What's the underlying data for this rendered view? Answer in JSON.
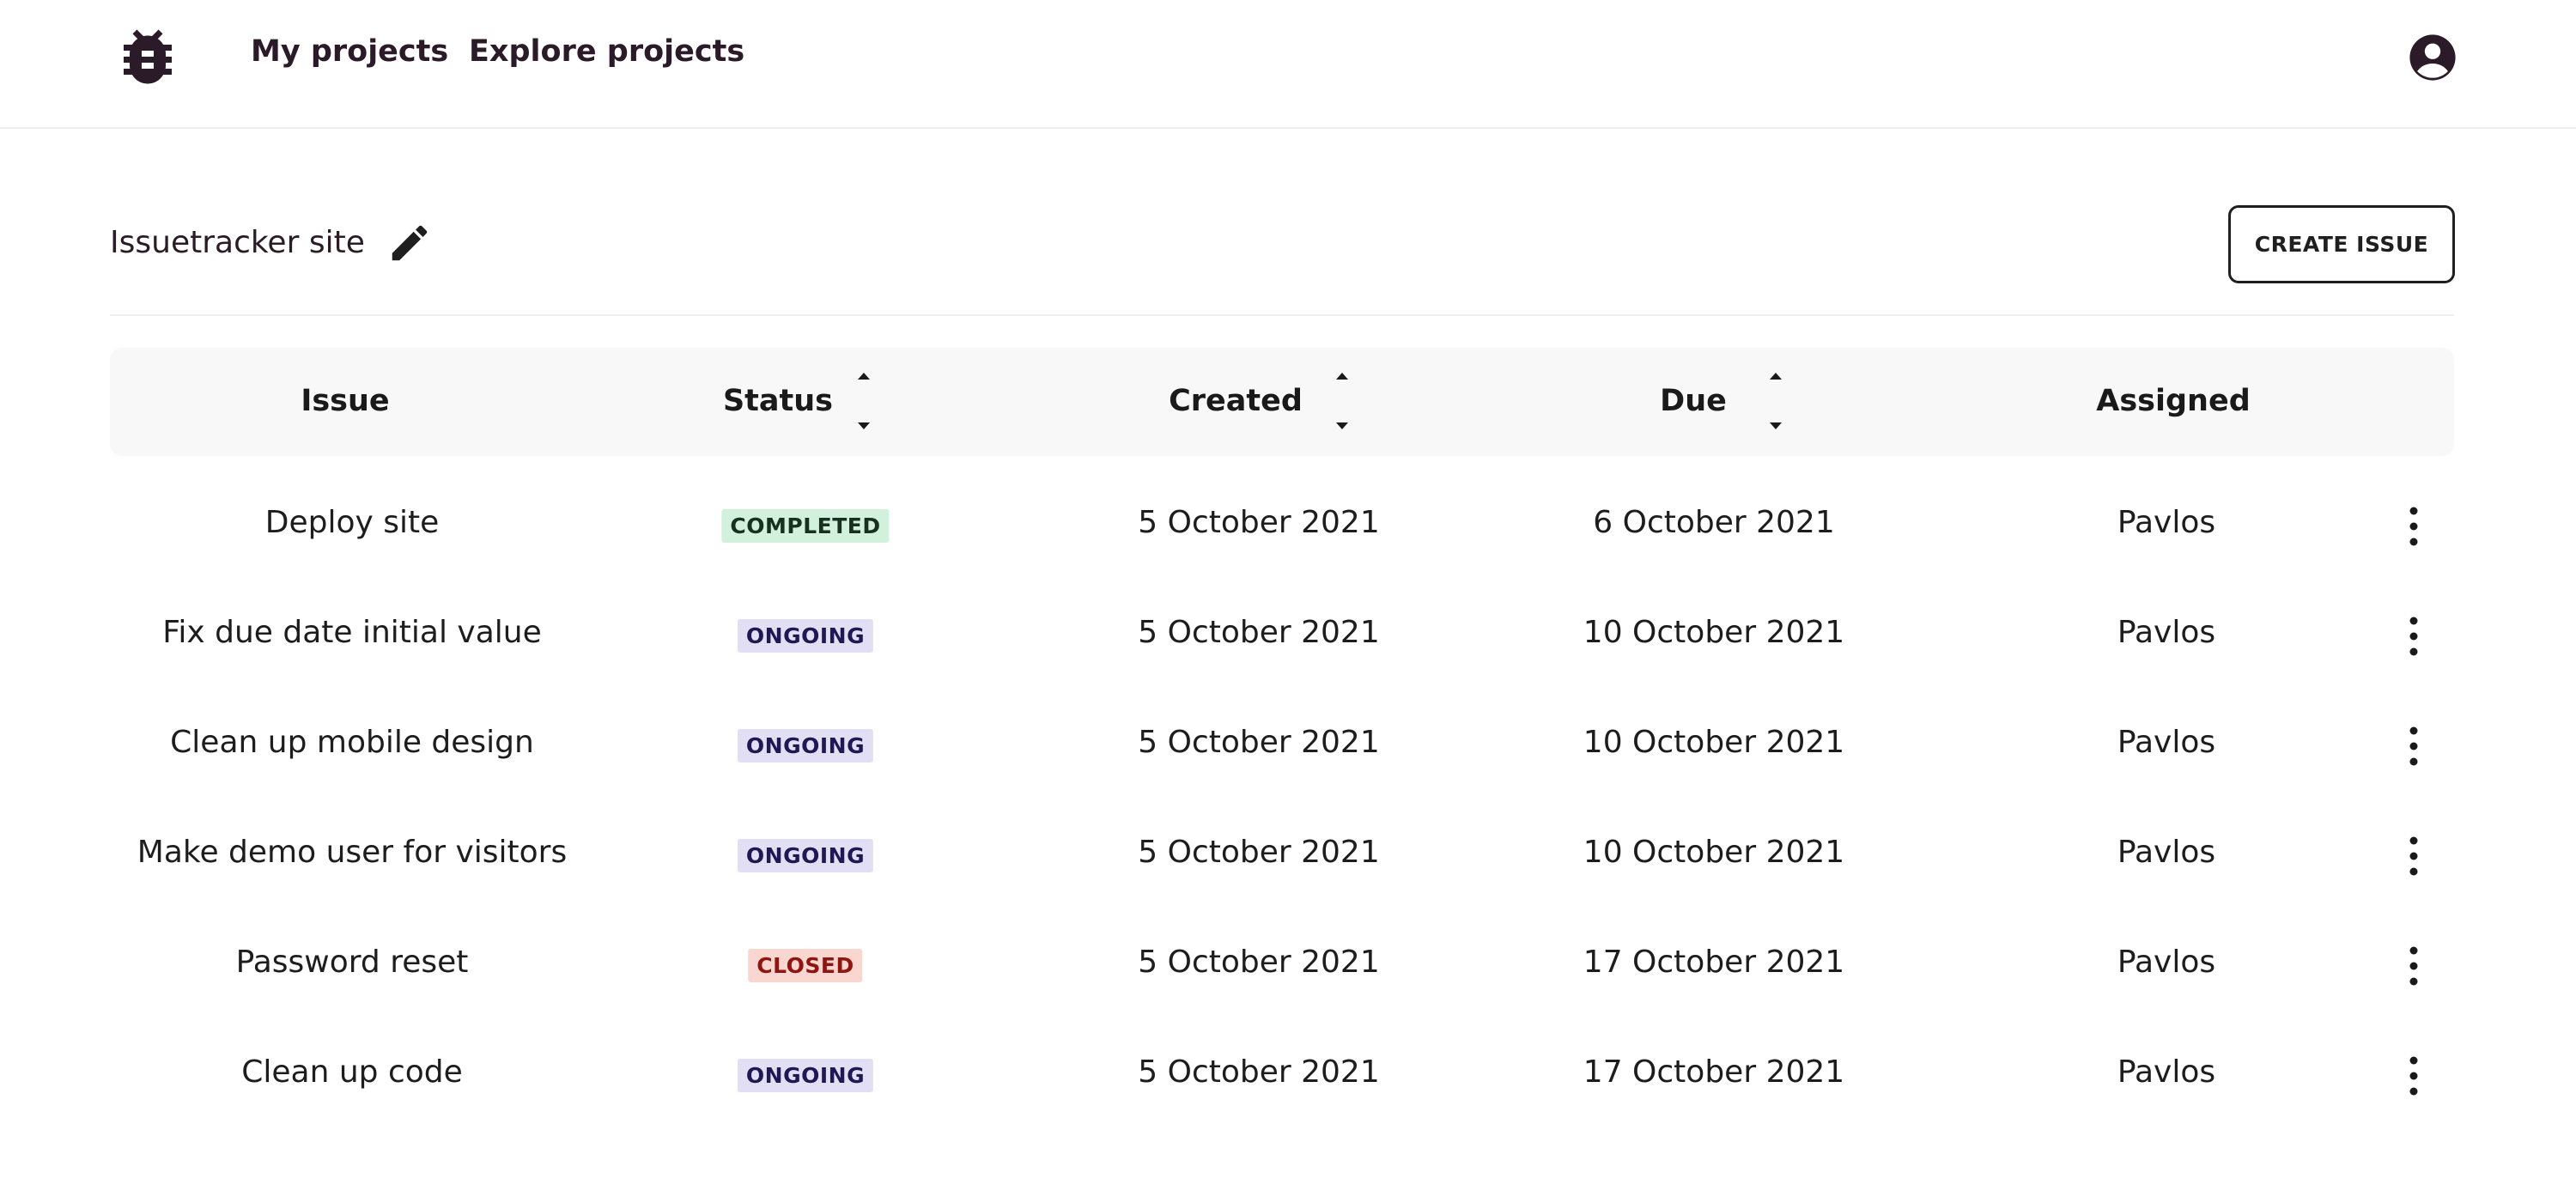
{
  "nav": {
    "logo_icon": "bug-icon",
    "my_projects": "My projects",
    "explore_projects": "Explore projects",
    "account_icon": "account-circle-icon"
  },
  "project": {
    "title": "Issuetracker site",
    "edit_icon": "pencil-icon",
    "create_issue": "CREATE ISSUE"
  },
  "table": {
    "columns": [
      {
        "label": "Issue",
        "sortable": false
      },
      {
        "label": "Status",
        "sortable": true
      },
      {
        "label": "Created",
        "sortable": true
      },
      {
        "label": "Due",
        "sortable": true
      },
      {
        "label": "Assigned",
        "sortable": false
      }
    ],
    "rows": [
      {
        "issue": "Deploy site",
        "status": "COMPLETED",
        "created": "5 October 2021",
        "due": "6 October 2021",
        "assigned": "Pavlos"
      },
      {
        "issue": "Fix due date initial value",
        "status": "ONGOING",
        "created": "5 October 2021",
        "due": "10 October 2021",
        "assigned": "Pavlos"
      },
      {
        "issue": "Clean up mobile design",
        "status": "ONGOING",
        "created": "5 October 2021",
        "due": "10 October 2021",
        "assigned": "Pavlos"
      },
      {
        "issue": "Make demo user for visitors",
        "status": "ONGOING",
        "created": "5 October 2021",
        "due": "10 October 2021",
        "assigned": "Pavlos"
      },
      {
        "issue": "Password reset",
        "status": "CLOSED",
        "created": "5 October 2021",
        "due": "17 October 2021",
        "assigned": "Pavlos"
      },
      {
        "issue": "Clean up code",
        "status": "ONGOING",
        "created": "5 October 2021",
        "due": "17 October 2021",
        "assigned": "Pavlos"
      }
    ]
  },
  "colors": {
    "brand_dark": "#2b1a27",
    "completed_bg": "#d1f1dd",
    "ongoing_bg": "#e2dff5",
    "closed_bg": "#f9d6cf",
    "closed_text": "#8f1412"
  }
}
